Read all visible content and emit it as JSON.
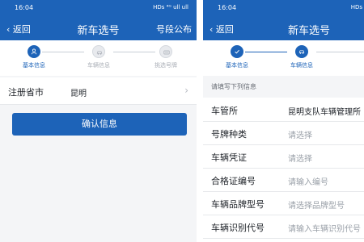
{
  "colors": {
    "primary": "#1d63b8",
    "background": "#f4f5f7",
    "row_text": "#1f2329",
    "placeholder": "#9aa0a8"
  },
  "screen1": {
    "status": {
      "time": "16:04",
      "icons": "HDs ⁴ᴳ ull ull"
    },
    "back_label": "返回",
    "title": "新车选号",
    "action_label": "号段公布",
    "steps": [
      {
        "label": "基本信息",
        "state": "active",
        "icon": "user-icon"
      },
      {
        "label": "车辆信息",
        "state": "inactive",
        "icon": "car-icon"
      },
      {
        "label": "挑选号牌",
        "state": "inactive",
        "icon": "plate-icon"
      }
    ],
    "field": {
      "label": "注册省市",
      "value": "昆明"
    },
    "confirm_label": "确认信息"
  },
  "screen2": {
    "status": {
      "time": "16:04",
      "icons": "HDs"
    },
    "back_label": "返回",
    "title": "新车选号",
    "steps": [
      {
        "label": "基本信息",
        "state": "done",
        "icon": "check-icon"
      },
      {
        "label": "车辆信息",
        "state": "active",
        "icon": "car-icon"
      }
    ],
    "hint": "请填写下列信息",
    "fields": [
      {
        "label": "车管所",
        "value": "昆明支队车辆管理所",
        "kind": "value"
      },
      {
        "label": "号牌种类",
        "value": "请选择",
        "kind": "placeholder"
      },
      {
        "label": "车辆凭证",
        "value": "请选择",
        "kind": "placeholder"
      },
      {
        "label": "合格证编号",
        "value": "请输入编号",
        "kind": "placeholder"
      },
      {
        "label": "车辆品牌型号",
        "value": "请选择品牌型号",
        "kind": "placeholder"
      },
      {
        "label": "车辆识别代号",
        "value": "请输入车辆识别代号",
        "kind": "placeholder"
      }
    ]
  }
}
